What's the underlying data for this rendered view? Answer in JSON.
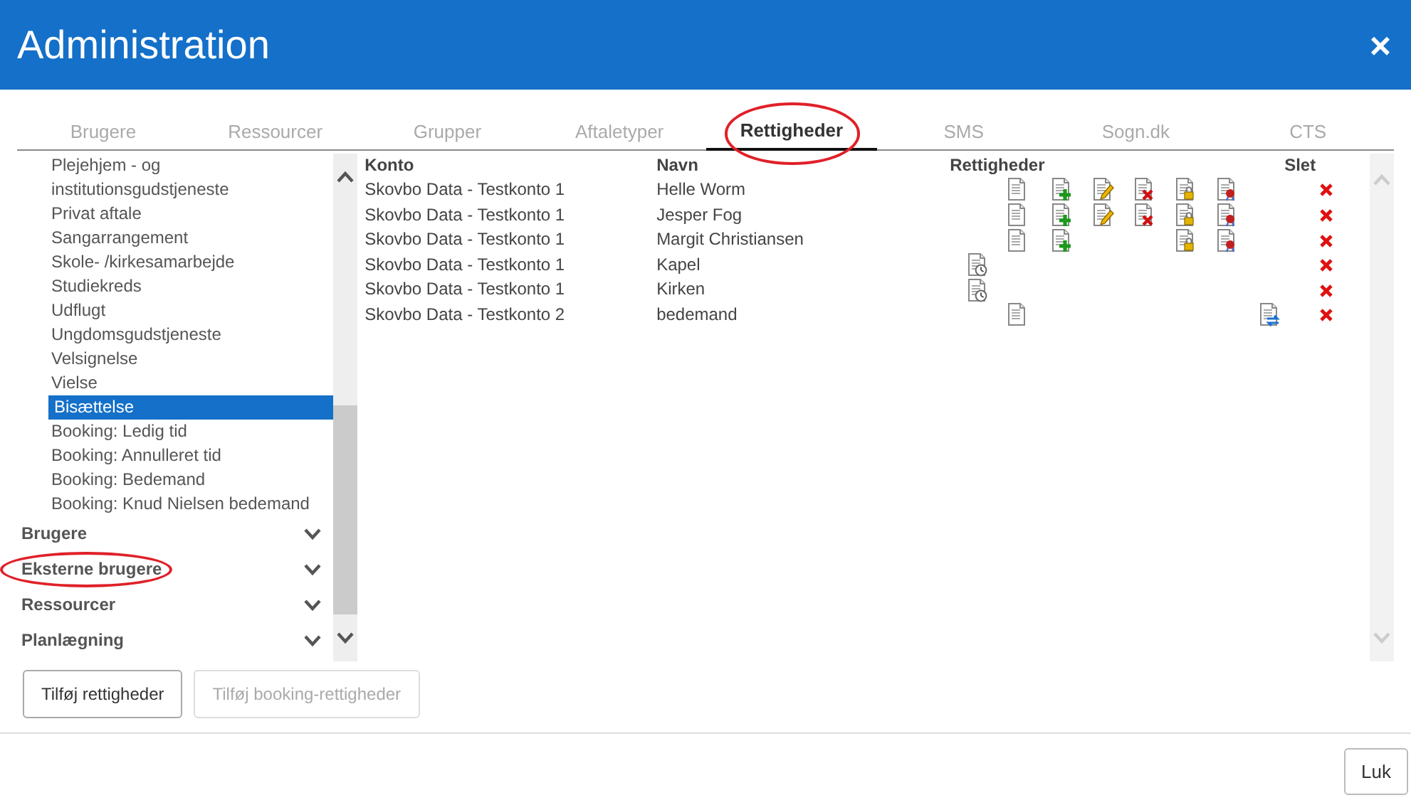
{
  "window": {
    "title": "Administration",
    "close": "×"
  },
  "tabs": [
    {
      "label": "Brugere",
      "selected": false,
      "circled": false
    },
    {
      "label": "Ressourcer",
      "selected": false,
      "circled": false
    },
    {
      "label": "Grupper",
      "selected": false,
      "circled": false
    },
    {
      "label": "Aftaletyper",
      "selected": false,
      "circled": false
    },
    {
      "label": "Rettigheder",
      "selected": true,
      "circled": true
    },
    {
      "label": "SMS",
      "selected": false,
      "circled": false
    },
    {
      "label": "Sogn.dk",
      "selected": false,
      "circled": false
    },
    {
      "label": "CTS",
      "selected": false,
      "circled": false
    }
  ],
  "sidebar": {
    "items": [
      {
        "label": "Plejehjem - og institutionsgudstjeneste",
        "selected": false
      },
      {
        "label": "Privat aftale",
        "selected": false
      },
      {
        "label": "Sangarrangement",
        "selected": false
      },
      {
        "label": "Skole- /kirkesamarbejde",
        "selected": false
      },
      {
        "label": "Studiekreds",
        "selected": false
      },
      {
        "label": "Udflugt",
        "selected": false
      },
      {
        "label": "Ungdomsgudstjeneste",
        "selected": false
      },
      {
        "label": "Velsignelse",
        "selected": false
      },
      {
        "label": "Vielse",
        "selected": false
      },
      {
        "label": "Bisættelse",
        "selected": true
      },
      {
        "label": "Booking: Ledig tid",
        "selected": false
      },
      {
        "label": "Booking: Annulleret tid",
        "selected": false
      },
      {
        "label": "Booking: Bedemand",
        "selected": false
      },
      {
        "label": "Booking: Knud Nielsen bedemand",
        "selected": false
      }
    ],
    "sections": [
      {
        "label": "Brugere",
        "expanded": false,
        "circled": false
      },
      {
        "label": "Eksterne brugere",
        "expanded": false,
        "circled": true
      },
      {
        "label": "Ressourcer",
        "expanded": false,
        "circled": false
      },
      {
        "label": "Planlægning",
        "expanded": false,
        "circled": false
      }
    ]
  },
  "table": {
    "columns": [
      "Konto",
      "Navn",
      "Rettigheder",
      "Slet"
    ],
    "rows": [
      {
        "konto": "Skovbo Data - Testkonto 1",
        "navn": "Helle Worm",
        "rights": [
          {
            "kind": "read"
          },
          {
            "kind": "add"
          },
          {
            "kind": "edit"
          },
          {
            "kind": "delete"
          },
          {
            "kind": "lock"
          },
          {
            "kind": "seal"
          }
        ]
      },
      {
        "konto": "Skovbo Data - Testkonto 1",
        "navn": "Jesper Fog",
        "rights": [
          {
            "kind": "read"
          },
          {
            "kind": "add"
          },
          {
            "kind": "edit"
          },
          {
            "kind": "delete"
          },
          {
            "kind": "lock"
          },
          {
            "kind": "seal"
          }
        ]
      },
      {
        "konto": "Skovbo Data - Testkonto 1",
        "navn": "Margit Christiansen",
        "rights": [
          {
            "kind": "read"
          },
          {
            "kind": "add"
          },
          {
            "kind": "lock"
          },
          {
            "kind": "seal"
          }
        ]
      },
      {
        "konto": "Skovbo Data - Testkonto 1",
        "navn": "Kapel",
        "rights": [
          {
            "kind": "clock"
          }
        ]
      },
      {
        "konto": "Skovbo Data - Testkonto 1",
        "navn": "Kirken",
        "rights": [
          {
            "kind": "clock"
          }
        ]
      },
      {
        "konto": "Skovbo Data - Testkonto 2",
        "navn": "bedemand",
        "rights": [
          {
            "kind": "read"
          },
          {
            "kind": "sync"
          }
        ]
      }
    ]
  },
  "buttons": [
    {
      "label": "Tilføj rettigheder",
      "disabled": false
    },
    {
      "label": "Tilføj booking-rettigheder",
      "disabled": true
    }
  ],
  "footer": {
    "close_button": "Luk"
  }
}
